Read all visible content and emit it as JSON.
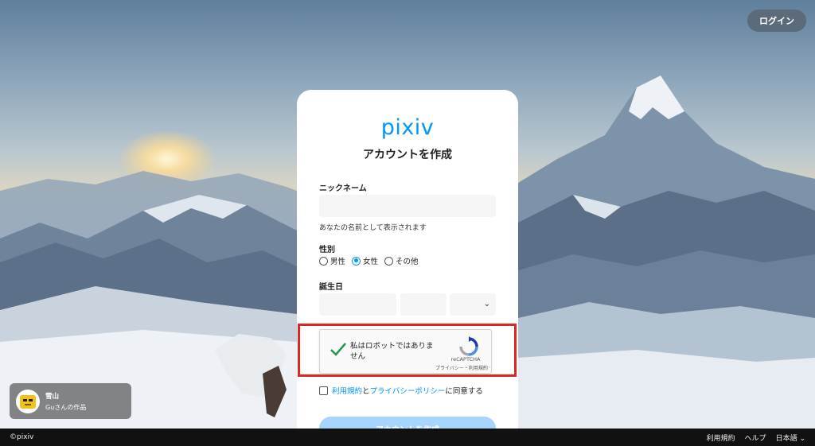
{
  "header": {
    "login_label": "ログイン"
  },
  "form": {
    "logo_text": "pixiv",
    "title": "アカウントを作成",
    "nickname_label": "ニックネーム",
    "nickname_hint": "あなたの名前として表示されます",
    "gender_label": "性別",
    "gender_options": [
      "男性",
      "女性",
      "その他"
    ],
    "gender_selected": "女性",
    "birthday_label": "誕生日",
    "recaptcha": {
      "text": "私はロボットではありません",
      "brand": "reCAPTCHA",
      "links": "プライバシー・利用規約"
    },
    "agree": {
      "terms_link": "利用規約",
      "and": "と",
      "privacy_link": "プライバシーポリシー",
      "suffix": "に同意する"
    },
    "submit_label": "アカウントを作成"
  },
  "artwork_credit": {
    "title": "雪山",
    "author": "Guさんの作品"
  },
  "footer": {
    "copyright": "©pixiv",
    "links": [
      "利用規約",
      "ヘルプ",
      "日本語"
    ]
  },
  "colors": {
    "accent": "#0096fa",
    "highlight": "#e0261f",
    "recaptcha_check": "#1e9a4a"
  }
}
